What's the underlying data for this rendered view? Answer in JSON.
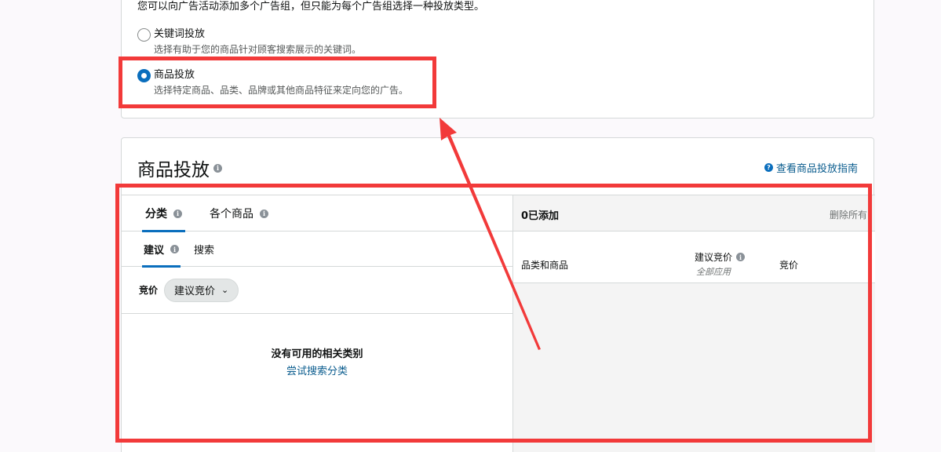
{
  "targeting_type_card": {
    "intro": "您可以向广告活动添加多个广告组，但只能为每个广告组选择一种投放类型。",
    "options": [
      {
        "label": "关键词投放",
        "description": "选择有助于您的商品针对顾客搜索展示的关键词。",
        "selected": false
      },
      {
        "label": "商品投放",
        "description": "选择特定商品、品类、品牌或其他商品特征来定向您的广告。",
        "selected": true
      }
    ]
  },
  "product_targeting": {
    "title": "商品投放",
    "guide_link": "查看商品投放指南",
    "tabs": [
      {
        "label": "分类",
        "active": true
      },
      {
        "label": "各个商品",
        "active": false
      }
    ],
    "subtabs": [
      {
        "label": "建议",
        "active": true
      },
      {
        "label": "搜索",
        "active": false
      }
    ],
    "bid_label": "竞价",
    "bid_select_value": "建议竞价",
    "empty_title": "没有可用的相关类别",
    "empty_link": "尝试搜索分类",
    "right_panel": {
      "added_count": "0已添加",
      "remove_all": "删除所有",
      "columns": {
        "category_products": "品类和商品",
        "suggested_bid": "建议竞价",
        "apply_all": "全部应用",
        "bid": "竞价"
      }
    }
  },
  "colors": {
    "accent": "#0a6ebd",
    "link": "#0a5c8e",
    "annotation": "#f23a3a"
  }
}
